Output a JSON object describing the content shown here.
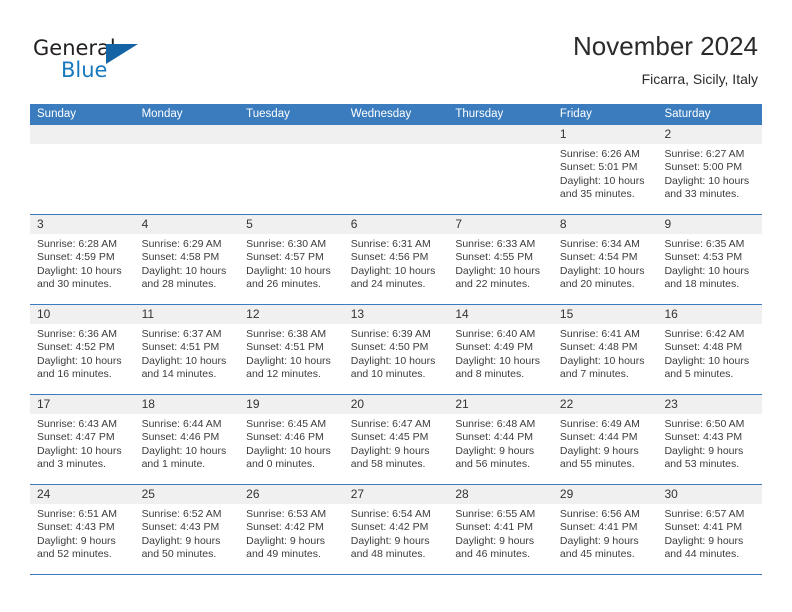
{
  "brand": {
    "name_part1": "General",
    "name_part2": "Blue",
    "accent_color": "#1879bf",
    "triangle_color": "#1464a5"
  },
  "header": {
    "title": "November 2024",
    "subtitle": "Ficarra, Sicily, Italy"
  },
  "theme": {
    "header_row_bg": "#3a7cbe",
    "day_band_bg": "#f0f0f0",
    "grid_line": "#3a7cbe",
    "text": "#3c3c3c"
  },
  "weekdays": [
    "Sunday",
    "Monday",
    "Tuesday",
    "Wednesday",
    "Thursday",
    "Friday",
    "Saturday"
  ],
  "weeks": [
    [
      {
        "day": "",
        "empty": true
      },
      {
        "day": "",
        "empty": true
      },
      {
        "day": "",
        "empty": true
      },
      {
        "day": "",
        "empty": true
      },
      {
        "day": "",
        "empty": true
      },
      {
        "day": "1",
        "sunrise": "Sunrise: 6:26 AM",
        "sunset": "Sunset: 5:01 PM",
        "daylight": "Daylight: 10 hours and 35 minutes."
      },
      {
        "day": "2",
        "sunrise": "Sunrise: 6:27 AM",
        "sunset": "Sunset: 5:00 PM",
        "daylight": "Daylight: 10 hours and 33 minutes."
      }
    ],
    [
      {
        "day": "3",
        "sunrise": "Sunrise: 6:28 AM",
        "sunset": "Sunset: 4:59 PM",
        "daylight": "Daylight: 10 hours and 30 minutes."
      },
      {
        "day": "4",
        "sunrise": "Sunrise: 6:29 AM",
        "sunset": "Sunset: 4:58 PM",
        "daylight": "Daylight: 10 hours and 28 minutes."
      },
      {
        "day": "5",
        "sunrise": "Sunrise: 6:30 AM",
        "sunset": "Sunset: 4:57 PM",
        "daylight": "Daylight: 10 hours and 26 minutes."
      },
      {
        "day": "6",
        "sunrise": "Sunrise: 6:31 AM",
        "sunset": "Sunset: 4:56 PM",
        "daylight": "Daylight: 10 hours and 24 minutes."
      },
      {
        "day": "7",
        "sunrise": "Sunrise: 6:33 AM",
        "sunset": "Sunset: 4:55 PM",
        "daylight": "Daylight: 10 hours and 22 minutes."
      },
      {
        "day": "8",
        "sunrise": "Sunrise: 6:34 AM",
        "sunset": "Sunset: 4:54 PM",
        "daylight": "Daylight: 10 hours and 20 minutes."
      },
      {
        "day": "9",
        "sunrise": "Sunrise: 6:35 AM",
        "sunset": "Sunset: 4:53 PM",
        "daylight": "Daylight: 10 hours and 18 minutes."
      }
    ],
    [
      {
        "day": "10",
        "sunrise": "Sunrise: 6:36 AM",
        "sunset": "Sunset: 4:52 PM",
        "daylight": "Daylight: 10 hours and 16 minutes."
      },
      {
        "day": "11",
        "sunrise": "Sunrise: 6:37 AM",
        "sunset": "Sunset: 4:51 PM",
        "daylight": "Daylight: 10 hours and 14 minutes."
      },
      {
        "day": "12",
        "sunrise": "Sunrise: 6:38 AM",
        "sunset": "Sunset: 4:51 PM",
        "daylight": "Daylight: 10 hours and 12 minutes."
      },
      {
        "day": "13",
        "sunrise": "Sunrise: 6:39 AM",
        "sunset": "Sunset: 4:50 PM",
        "daylight": "Daylight: 10 hours and 10 minutes."
      },
      {
        "day": "14",
        "sunrise": "Sunrise: 6:40 AM",
        "sunset": "Sunset: 4:49 PM",
        "daylight": "Daylight: 10 hours and 8 minutes."
      },
      {
        "day": "15",
        "sunrise": "Sunrise: 6:41 AM",
        "sunset": "Sunset: 4:48 PM",
        "daylight": "Daylight: 10 hours and 7 minutes."
      },
      {
        "day": "16",
        "sunrise": "Sunrise: 6:42 AM",
        "sunset": "Sunset: 4:48 PM",
        "daylight": "Daylight: 10 hours and 5 minutes."
      }
    ],
    [
      {
        "day": "17",
        "sunrise": "Sunrise: 6:43 AM",
        "sunset": "Sunset: 4:47 PM",
        "daylight": "Daylight: 10 hours and 3 minutes."
      },
      {
        "day": "18",
        "sunrise": "Sunrise: 6:44 AM",
        "sunset": "Sunset: 4:46 PM",
        "daylight": "Daylight: 10 hours and 1 minute."
      },
      {
        "day": "19",
        "sunrise": "Sunrise: 6:45 AM",
        "sunset": "Sunset: 4:46 PM",
        "daylight": "Daylight: 10 hours and 0 minutes."
      },
      {
        "day": "20",
        "sunrise": "Sunrise: 6:47 AM",
        "sunset": "Sunset: 4:45 PM",
        "daylight": "Daylight: 9 hours and 58 minutes."
      },
      {
        "day": "21",
        "sunrise": "Sunrise: 6:48 AM",
        "sunset": "Sunset: 4:44 PM",
        "daylight": "Daylight: 9 hours and 56 minutes."
      },
      {
        "day": "22",
        "sunrise": "Sunrise: 6:49 AM",
        "sunset": "Sunset: 4:44 PM",
        "daylight": "Daylight: 9 hours and 55 minutes."
      },
      {
        "day": "23",
        "sunrise": "Sunrise: 6:50 AM",
        "sunset": "Sunset: 4:43 PM",
        "daylight": "Daylight: 9 hours and 53 minutes."
      }
    ],
    [
      {
        "day": "24",
        "sunrise": "Sunrise: 6:51 AM",
        "sunset": "Sunset: 4:43 PM",
        "daylight": "Daylight: 9 hours and 52 minutes."
      },
      {
        "day": "25",
        "sunrise": "Sunrise: 6:52 AM",
        "sunset": "Sunset: 4:43 PM",
        "daylight": "Daylight: 9 hours and 50 minutes."
      },
      {
        "day": "26",
        "sunrise": "Sunrise: 6:53 AM",
        "sunset": "Sunset: 4:42 PM",
        "daylight": "Daylight: 9 hours and 49 minutes."
      },
      {
        "day": "27",
        "sunrise": "Sunrise: 6:54 AM",
        "sunset": "Sunset: 4:42 PM",
        "daylight": "Daylight: 9 hours and 48 minutes."
      },
      {
        "day": "28",
        "sunrise": "Sunrise: 6:55 AM",
        "sunset": "Sunset: 4:41 PM",
        "daylight": "Daylight: 9 hours and 46 minutes."
      },
      {
        "day": "29",
        "sunrise": "Sunrise: 6:56 AM",
        "sunset": "Sunset: 4:41 PM",
        "daylight": "Daylight: 9 hours and 45 minutes."
      },
      {
        "day": "30",
        "sunrise": "Sunrise: 6:57 AM",
        "sunset": "Sunset: 4:41 PM",
        "daylight": "Daylight: 9 hours and 44 minutes."
      }
    ]
  ]
}
